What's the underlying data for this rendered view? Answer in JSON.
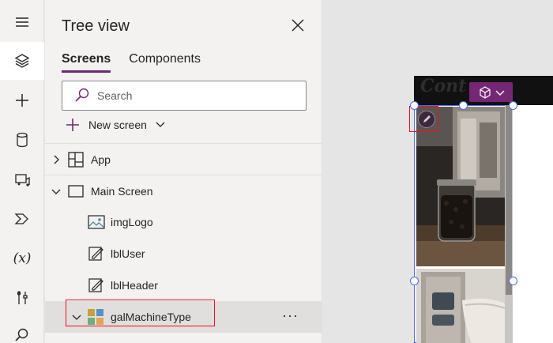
{
  "panel": {
    "title": "Tree view",
    "tabs": [
      {
        "label": "Screens",
        "active": true
      },
      {
        "label": "Components",
        "active": false
      }
    ],
    "search_placeholder": "Search",
    "new_screen_label": "New screen"
  },
  "tree": {
    "app": {
      "label": "App"
    },
    "main_screen": {
      "label": "Main Screen"
    },
    "items": [
      {
        "label": "imgLogo",
        "icon": "image-icon"
      },
      {
        "label": "lblUser",
        "icon": "edit-label-icon"
      },
      {
        "label": "lblHeader",
        "icon": "edit-label-icon"
      },
      {
        "label": "galMachineType",
        "icon": "gallery-icon",
        "selected": true
      }
    ],
    "more_label": "···"
  },
  "canvas": {
    "logo_text": "Cont"
  },
  "colors": {
    "accent": "#742774",
    "selection": "#4f6bed",
    "highlight": "#e81123"
  },
  "rail_icons": [
    "hamburger-icon",
    "layers-icon",
    "plus-icon",
    "database-icon",
    "media-icon",
    "power-automate-icon",
    "variables-icon",
    "tools-icon",
    "search-icon"
  ]
}
